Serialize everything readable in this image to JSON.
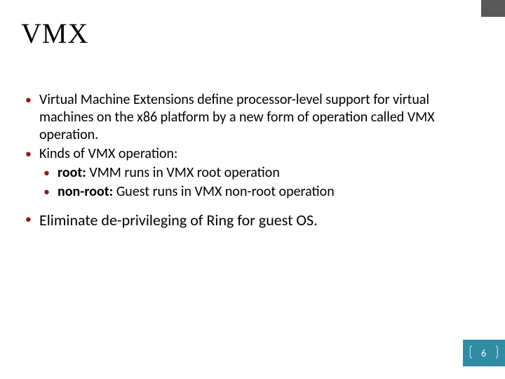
{
  "title": "VMX",
  "bullets": {
    "b1": "Virtual Machine Extensions define processor-level support for virtual machines on the x86 platform by a new form of operation called VMX operation.",
    "b2": "Kinds of VMX operation:",
    "b2a_label": "root:",
    "b2a_rest": " VMM runs in VMX root operation",
    "b2b_label": "non-root:",
    "b2b_rest": " Guest runs in VMX non-root operation",
    "b3": "Eliminate de-privileging of Ring for guest OS."
  },
  "bullet_glyph": "•",
  "page_number": "6",
  "bracket_left": "〔",
  "bracket_right": "〕",
  "accent_color": "#2f8ca3"
}
